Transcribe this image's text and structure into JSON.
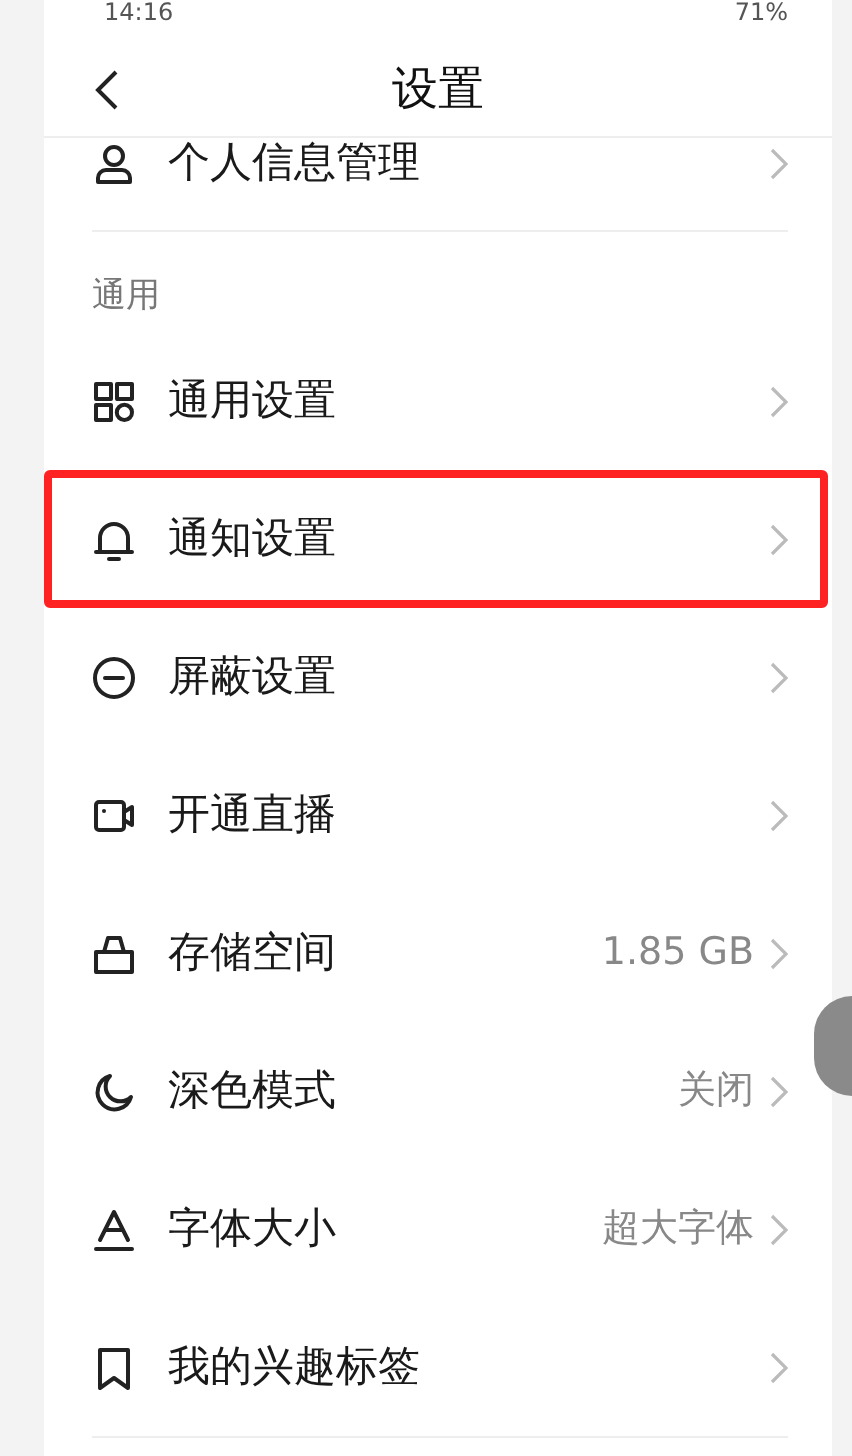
{
  "status_bar": {
    "time": "14:16",
    "battery": "71%"
  },
  "header": {
    "title": "设置"
  },
  "top_item": {
    "label": "个人信息管理",
    "kind": "person"
  },
  "sections": [
    {
      "title": "通用",
      "items": [
        {
          "label": "通用设置",
          "kind": "grid",
          "highlighted": false
        },
        {
          "label": "通知设置",
          "kind": "bell",
          "highlighted": true
        },
        {
          "label": "屏蔽设置",
          "kind": "minus",
          "highlighted": false
        },
        {
          "label": "开通直播",
          "kind": "camera",
          "highlighted": false
        },
        {
          "label": "存储空间",
          "kind": "basket",
          "value": "1.85 GB",
          "highlighted": false
        },
        {
          "label": "深色模式",
          "kind": "moon",
          "value": "关闭",
          "highlighted": false
        },
        {
          "label": "字体大小",
          "kind": "font",
          "value": "超大字体",
          "highlighted": false
        },
        {
          "label": "我的兴趣标签",
          "kind": "bookmark",
          "highlighted": false
        }
      ]
    }
  ]
}
